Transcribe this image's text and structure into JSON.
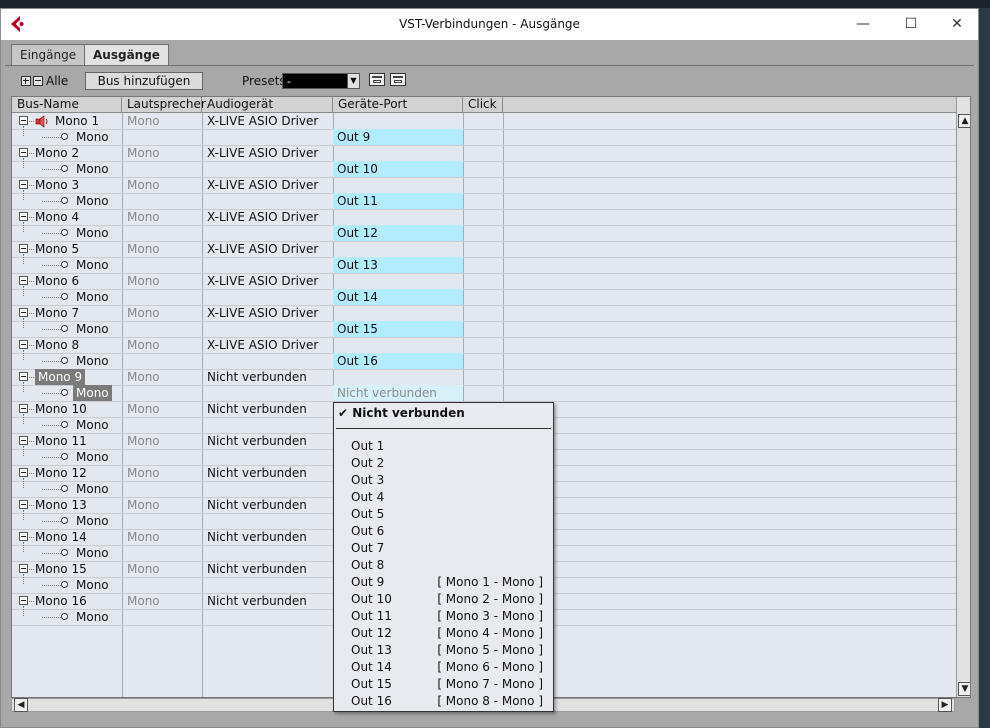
{
  "window": {
    "title": "VST-Verbindungen - Ausgänge",
    "controls": {
      "minimize": "—",
      "maximize": "☐",
      "close": "✕"
    }
  },
  "tabs": [
    {
      "label": "Eingänge",
      "active": false
    },
    {
      "label": "Ausgänge",
      "active": true
    }
  ],
  "toolbar": {
    "all_label": "Alle",
    "add_bus_label": "Bus hinzufügen",
    "presets_label": "Presets",
    "presets_value": "-"
  },
  "columns": [
    "Bus-Name",
    "Lautsprecher",
    "Audiogerät",
    "Geräte-Port",
    "Click"
  ],
  "buses": [
    {
      "name": "Mono 1",
      "speaker": "Mono",
      "device": "X-LIVE ASIO Driver",
      "channel": "Mono",
      "port": "Out 9",
      "has_speaker_icon": true
    },
    {
      "name": "Mono 2",
      "speaker": "Mono",
      "device": "X-LIVE ASIO Driver",
      "channel": "Mono",
      "port": "Out 10"
    },
    {
      "name": "Mono 3",
      "speaker": "Mono",
      "device": "X-LIVE ASIO Driver",
      "channel": "Mono",
      "port": "Out 11"
    },
    {
      "name": "Mono 4",
      "speaker": "Mono",
      "device": "X-LIVE ASIO Driver",
      "channel": "Mono",
      "port": "Out 12"
    },
    {
      "name": "Mono 5",
      "speaker": "Mono",
      "device": "X-LIVE ASIO Driver",
      "channel": "Mono",
      "port": "Out 13"
    },
    {
      "name": "Mono 6",
      "speaker": "Mono",
      "device": "X-LIVE ASIO Driver",
      "channel": "Mono",
      "port": "Out 14"
    },
    {
      "name": "Mono 7",
      "speaker": "Mono",
      "device": "X-LIVE ASIO Driver",
      "channel": "Mono",
      "port": "Out 15"
    },
    {
      "name": "Mono 8",
      "speaker": "Mono",
      "device": "X-LIVE ASIO Driver",
      "channel": "Mono",
      "port": "Out 16"
    },
    {
      "name": "Mono 9",
      "speaker": "Mono",
      "device": "Nicht verbunden",
      "channel": "Mono",
      "port": "Nicht verbunden",
      "selected": true
    },
    {
      "name": "Mono 10",
      "speaker": "Mono",
      "device": "Nicht verbunden",
      "channel": "Mono",
      "port": ""
    },
    {
      "name": "Mono 11",
      "speaker": "Mono",
      "device": "Nicht verbunden",
      "channel": "Mono",
      "port": ""
    },
    {
      "name": "Mono 12",
      "speaker": "Mono",
      "device": "Nicht verbunden",
      "channel": "Mono",
      "port": ""
    },
    {
      "name": "Mono 13",
      "speaker": "Mono",
      "device": "Nicht verbunden",
      "channel": "Mono",
      "port": ""
    },
    {
      "name": "Mono 14",
      "speaker": "Mono",
      "device": "Nicht verbunden",
      "channel": "Mono",
      "port": ""
    },
    {
      "name": "Mono 15",
      "speaker": "Mono",
      "device": "Nicht verbunden",
      "channel": "Mono",
      "port": ""
    },
    {
      "name": "Mono 16",
      "speaker": "Mono",
      "device": "Nicht verbunden",
      "channel": "Mono",
      "port": ""
    }
  ],
  "port_menu": {
    "checked_item": "Nicht verbunden",
    "items": [
      {
        "label": "Out 1",
        "assigned": ""
      },
      {
        "label": "Out 2",
        "assigned": ""
      },
      {
        "label": "Out 3",
        "assigned": ""
      },
      {
        "label": "Out 4",
        "assigned": ""
      },
      {
        "label": "Out 5",
        "assigned": ""
      },
      {
        "label": "Out 6",
        "assigned": ""
      },
      {
        "label": "Out 7",
        "assigned": ""
      },
      {
        "label": "Out 8",
        "assigned": ""
      },
      {
        "label": "Out 9",
        "assigned": "[ Mono 1 - Mono ]"
      },
      {
        "label": "Out 10",
        "assigned": "[ Mono 2 - Mono ]"
      },
      {
        "label": "Out 11",
        "assigned": "[ Mono 3 - Mono ]"
      },
      {
        "label": "Out 12",
        "assigned": "[ Mono 4 - Mono ]"
      },
      {
        "label": "Out 13",
        "assigned": "[ Mono 5 - Mono ]"
      },
      {
        "label": "Out 14",
        "assigned": "[ Mono 6 - Mono ]"
      },
      {
        "label": "Out 15",
        "assigned": "[ Mono 7 - Mono ]"
      },
      {
        "label": "Out 16",
        "assigned": "[ Mono 8 - Mono ]"
      }
    ]
  },
  "colors": {
    "port_highlight": "#b3ecff",
    "grid_background": "#e3e7ee",
    "brand": "#b0001f"
  }
}
